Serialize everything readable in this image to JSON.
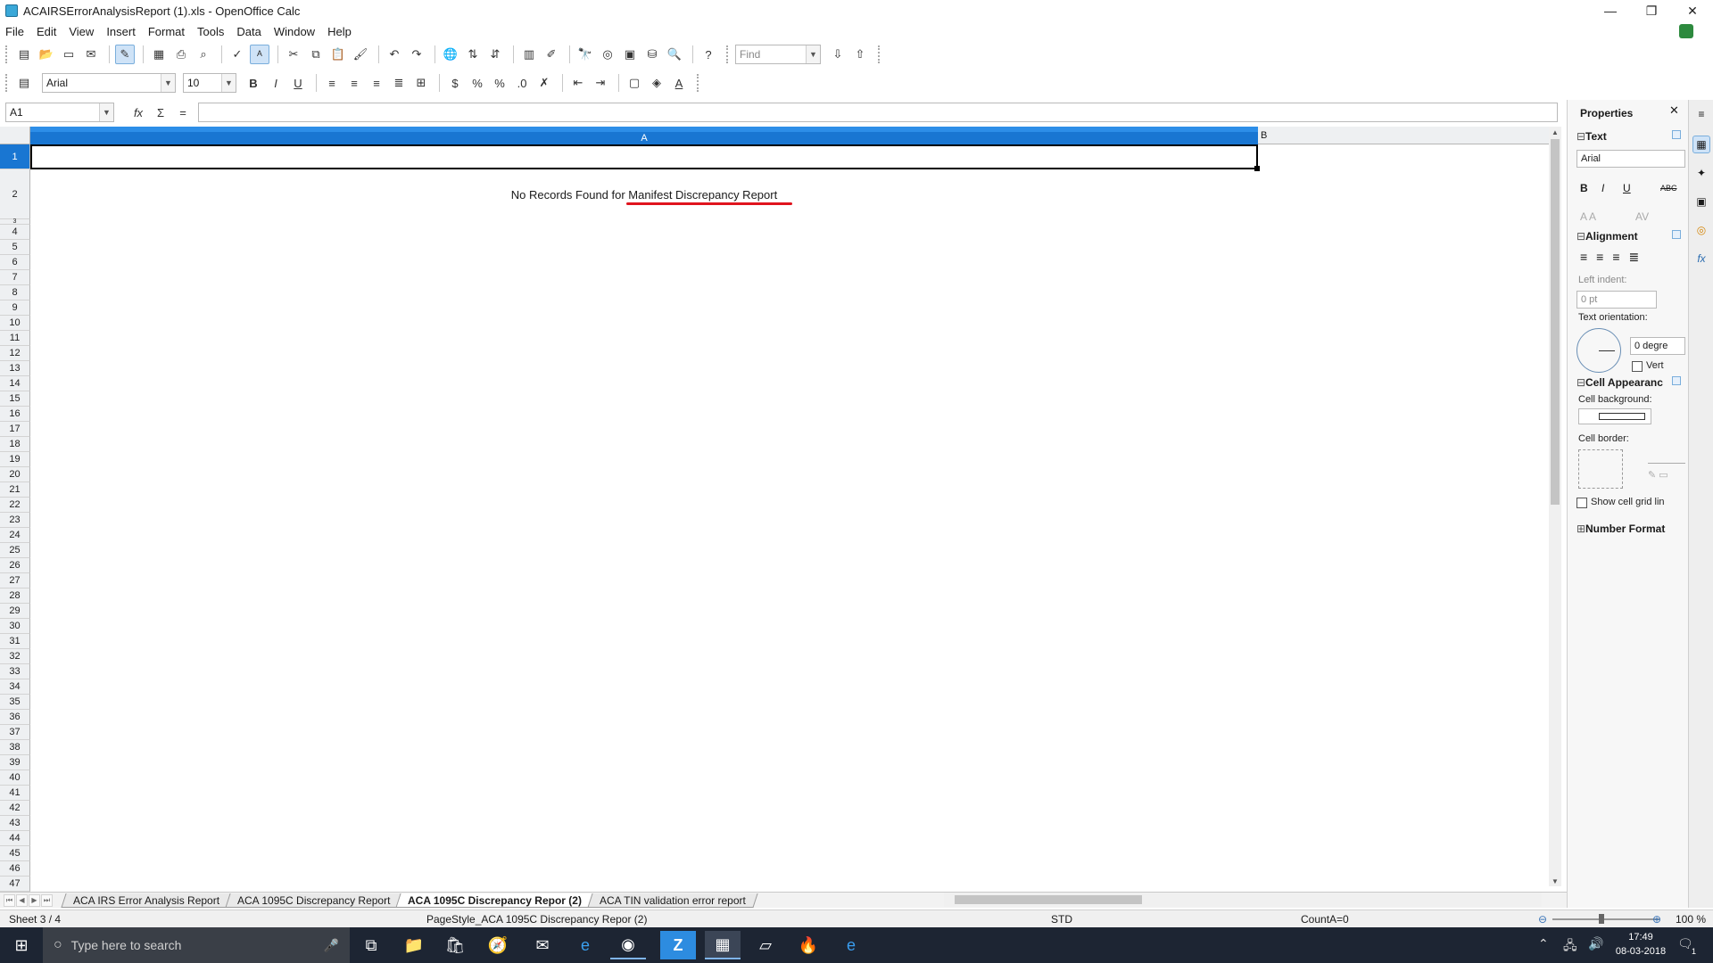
{
  "window": {
    "title": "ACAIRSErrorAnalysisReport (1).xls - OpenOffice Calc",
    "minimize": "—",
    "restore": "❐",
    "close": "✕"
  },
  "menu": [
    "File",
    "Edit",
    "View",
    "Insert",
    "Format",
    "Tools",
    "Data",
    "Window",
    "Help"
  ],
  "toolbar": {
    "find_placeholder": "Find",
    "font_name": "Arial",
    "font_size": "10",
    "bold": "B",
    "italic": "I",
    "underline": "U",
    "percent": "%"
  },
  "formula_bar": {
    "cell_reference": "A1",
    "content": ""
  },
  "grid": {
    "column_headers": [
      "A",
      "B"
    ],
    "row_headers": [
      "1",
      "2",
      "3",
      "4",
      "5",
      "6",
      "7",
      "8",
      "9",
      "10",
      "11",
      "12",
      "13",
      "14",
      "15",
      "16",
      "17",
      "18",
      "19",
      "20",
      "21",
      "22",
      "23",
      "24",
      "25",
      "26",
      "27",
      "28",
      "29",
      "30",
      "31",
      "32",
      "33",
      "34",
      "35",
      "36",
      "37",
      "38",
      "39",
      "40",
      "41",
      "42",
      "43",
      "44",
      "45",
      "46",
      "47"
    ],
    "selected_cell": "A1",
    "cells": {
      "A2": "No Records Found for Manifest Discrepancy Report"
    },
    "annotation_color": "#e0141e"
  },
  "sheet_tabs": [
    {
      "label": "ACA IRS Error Analysis Report",
      "active": false
    },
    {
      "label": "ACA 1095C Discrepancy Report",
      "active": false
    },
    {
      "label": "ACA 1095C Discrepancy Repor (2)",
      "active": true
    },
    {
      "label": "ACA TIN validation error report",
      "active": false
    }
  ],
  "status": {
    "sheet": "Sheet 3 / 4",
    "page_style": "PageStyle_ACA 1095C Discrepancy Repor (2)",
    "mode": "STD",
    "sum": "CountA=0",
    "zoom": "100 %"
  },
  "sidebar": {
    "title": "Properties",
    "text_section": "Text",
    "font": "Arial",
    "alignment_section": "Alignment",
    "left_indent_label": "Left indent:",
    "left_indent_value": "0 pt",
    "text_orientation_label": "Text orientation:",
    "degrees_value": "0 degre",
    "vertical_label": "Vert",
    "cell_appearance_section": "Cell Appearanc",
    "cell_background_label": "Cell background:",
    "cell_border_label": "Cell border:",
    "show_grid_label": "Show cell grid lin",
    "number_format_section": "Number Format"
  },
  "taskbar": {
    "search_placeholder": "Type here to search",
    "time": "17:49",
    "date": "08-03-2018",
    "notification_count": "1"
  },
  "colors": {
    "column_header_selected": "#1976d2",
    "taskbar": "#1d2533"
  }
}
